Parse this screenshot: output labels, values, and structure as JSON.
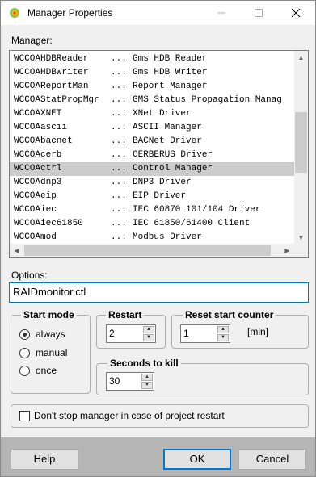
{
  "window": {
    "title": "Manager Properties"
  },
  "manager": {
    "label": "Manager:",
    "items": [
      {
        "name": "WCCOAHDBReader",
        "sep": "...",
        "desc": "Gms HDB Reader"
      },
      {
        "name": "WCCOAHDBWriter",
        "sep": "...",
        "desc": "Gms HDB Writer"
      },
      {
        "name": "WCCOAReportMan",
        "sep": "...",
        "desc": "Report Manager"
      },
      {
        "name": "WCCOAStatPropMgr",
        "sep": "...",
        "desc": "GMS Status Propagation Manag"
      },
      {
        "name": "WCCOAXNET",
        "sep": "...",
        "desc": "XNet Driver"
      },
      {
        "name": "WCCOAascii",
        "sep": "...",
        "desc": "ASCII Manager"
      },
      {
        "name": "WCCOAbacnet",
        "sep": "...",
        "desc": "BACNet Driver"
      },
      {
        "name": "WCCOAcerb",
        "sep": "...",
        "desc": "CERBERUS Driver"
      },
      {
        "name": "WCCOActrl",
        "sep": "...",
        "desc": "Control Manager",
        "selected": true
      },
      {
        "name": "WCCOAdnp3",
        "sep": "...",
        "desc": "DNP3 Driver"
      },
      {
        "name": "WCCOAeip",
        "sep": "...",
        "desc": "EIP Driver"
      },
      {
        "name": "WCCOAiec",
        "sep": "...",
        "desc": "IEC 60870 101/104 Driver"
      },
      {
        "name": "WCCOAiec61850",
        "sep": "...",
        "desc": "IEC 61850/61400 Client"
      },
      {
        "name": "WCCOAmod",
        "sep": "...",
        "desc": "Modbus Driver"
      }
    ]
  },
  "options": {
    "label": "Options:",
    "value": "RAIDmonitor.ctl"
  },
  "start_mode": {
    "title": "Start mode",
    "options": [
      "always",
      "manual",
      "once"
    ],
    "selected": "always"
  },
  "restart": {
    "title": "Restart",
    "value": "2"
  },
  "reset_counter": {
    "title": "Reset start counter",
    "value": "1",
    "unit": "[min]"
  },
  "seconds_to_kill": {
    "title": "Seconds to kill",
    "value": "30"
  },
  "dont_stop": {
    "label": "Don't stop manager in case of project restart",
    "checked": false
  },
  "buttons": {
    "help": "Help",
    "ok": "OK",
    "cancel": "Cancel"
  },
  "colors": {
    "selection": "#cccccc",
    "focus": "#0078d7",
    "bottom_bar": "#b5b5b5"
  }
}
